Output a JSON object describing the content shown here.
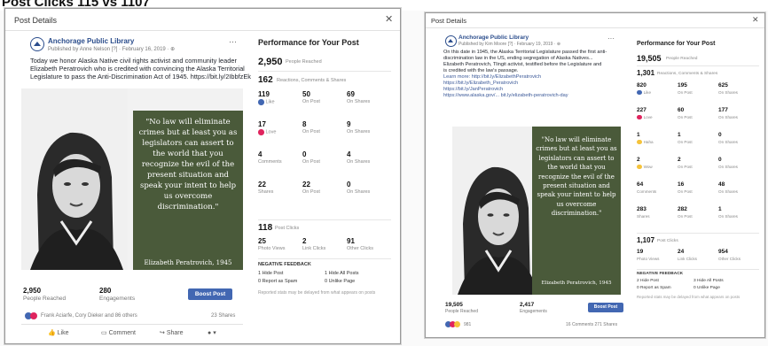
{
  "caption": "Post Clicks 115 vs 1107",
  "modal": {
    "title": "Post Details",
    "close_icon": "close-icon",
    "more_icon": "more-icon"
  },
  "left": {
    "page_name": "Anchorage Public Library",
    "meta": "Published by Anne Nelson [?] · February 16, 2019 · ",
    "post_lines": [
      "Today we honor Alaska Native civil rights activist and community leader",
      "Elizabeth Peratrovich who is credited with convincing the Alaska Territorial",
      "Legislature to pass the Anti-Discrimination Act of 1945. https://bit.ly/2IbbfzEk"
    ],
    "quote": "\"No law will eliminate crimes but at least you as legislators can assert to the world that you recognize the evil of the present situation and speak your intent to help us overcome discrimination.\"",
    "quote_attr": "Elizabeth Peratrovich, 1945",
    "reached": "2,950",
    "reached_label": "People Reached",
    "engagements": "280",
    "engagements_label": "Engagements",
    "boost": "Boost Post",
    "reactors": "Frank Aciarfe, Cory Dieker and 86 others",
    "shares": "23 Shares",
    "actions": {
      "like": "Like",
      "comment": "Comment",
      "share": "Share"
    },
    "perf": {
      "title": "Performance for Your Post",
      "reached": "2,950",
      "reached_label": "People Reached",
      "reactions": "162",
      "reactions_label": "Reactions, Comments & Shares",
      "grid": [
        {
          "n": "119",
          "l": "Like",
          "c": "#4267b2"
        },
        {
          "n": "50",
          "l": "On Post",
          "c": ""
        },
        {
          "n": "69",
          "l": "On Shares",
          "c": ""
        },
        {
          "n": "17",
          "l": "Love",
          "c": "#e0245e"
        },
        {
          "n": "8",
          "l": "On Post",
          "c": ""
        },
        {
          "n": "9",
          "l": "On Shares",
          "c": ""
        },
        {
          "n": "4",
          "l": "Comments",
          "c": ""
        },
        {
          "n": "0",
          "l": "On Post",
          "c": ""
        },
        {
          "n": "4",
          "l": "On Shares",
          "c": ""
        },
        {
          "n": "22",
          "l": "Shares",
          "c": ""
        },
        {
          "n": "22",
          "l": "On Post",
          "c": ""
        },
        {
          "n": "0",
          "l": "On Shares",
          "c": ""
        }
      ],
      "clicks": "118",
      "clicks_label": "Post Clicks",
      "click_grid": [
        {
          "n": "25",
          "l": "Photo Views"
        },
        {
          "n": "2",
          "l": "Link Clicks"
        },
        {
          "n": "91",
          "l": "Other Clicks"
        }
      ],
      "neg_title": "NEGATIVE FEEDBACK",
      "neg": [
        "1 Hide Post",
        "1 Hide All Posts",
        "0 Report as Spam",
        "0 Unlike Page"
      ],
      "note": "Reported stats may be delayed from what appears on posts"
    }
  },
  "right": {
    "page_name": "Anchorage Public Library",
    "meta": "Published by Kim Moore [?] · February 19, 2019 · ",
    "post_lines": [
      "On this date in 1945, the Alaska Territorial Legislature passed the first anti-",
      "discrimination law in the US, ending segregation of Alaska Natives...",
      "Elizabeth Peratrovich, Tlingit activist, testified before the Legislature and",
      "is credited with the law's passage.",
      "Learn more: http://bit.ly/ElizabethPeratrovich",
      "https://bit.ly/Elizabeth_Peratrovich",
      "https://bit.ly/JanPeratrovich",
      "https://www.alaska.gov/... bit.ly/elizabeth-peratrovich-day"
    ],
    "quote": "\"No law will eliminate crimes but at least you as legislators can assert to the world that you recognize the evil of the present situation and speak your intent to help us overcome discrimination.\"",
    "quote_attr": "Elizabeth Peratrovich, 1945",
    "reached": "19,505",
    "reached_label": "People Reached",
    "engagements": "2,417",
    "engagements_label": "Engagements",
    "boost": "Boost Post",
    "reactors": "981",
    "shares": "16 Comments 271 Shares",
    "perf": {
      "title": "Performance for Your Post",
      "reached": "19,505",
      "reached_label": "People Reached",
      "reactions": "1,301",
      "reactions_label": "Reactions, Comments & Shares",
      "grid": [
        {
          "n": "820",
          "l": "Like",
          "c": "#4267b2"
        },
        {
          "n": "195",
          "l": "On Post",
          "c": ""
        },
        {
          "n": "625",
          "l": "On Shares",
          "c": ""
        },
        {
          "n": "227",
          "l": "Love",
          "c": "#e0245e"
        },
        {
          "n": "60",
          "l": "On Post",
          "c": ""
        },
        {
          "n": "177",
          "l": "On Shares",
          "c": ""
        },
        {
          "n": "1",
          "l": "Haha",
          "c": "#f5c33b"
        },
        {
          "n": "1",
          "l": "On Post",
          "c": ""
        },
        {
          "n": "0",
          "l": "On Shares",
          "c": ""
        },
        {
          "n": "2",
          "l": "Wow",
          "c": "#f5c33b"
        },
        {
          "n": "2",
          "l": "On Post",
          "c": ""
        },
        {
          "n": "0",
          "l": "On Shares",
          "c": ""
        },
        {
          "n": "64",
          "l": "Comments",
          "c": ""
        },
        {
          "n": "16",
          "l": "On Post",
          "c": ""
        },
        {
          "n": "48",
          "l": "On Shares",
          "c": ""
        },
        {
          "n": "283",
          "l": "Shares",
          "c": ""
        },
        {
          "n": "282",
          "l": "On Post",
          "c": ""
        },
        {
          "n": "1",
          "l": "On Shares",
          "c": ""
        }
      ],
      "clicks": "1,107",
      "clicks_label": "Post Clicks",
      "click_grid": [
        {
          "n": "19",
          "l": "Photo Views"
        },
        {
          "n": "24",
          "l": "Link Clicks"
        },
        {
          "n": "954",
          "l": "Other Clicks"
        }
      ],
      "neg_title": "NEGATIVE FEEDBACK",
      "neg": [
        "2 Hide Post",
        "3 Hide All Posts",
        "0 Report as Spam",
        "0 Unlike Page"
      ],
      "note": "Reported stats may be delayed from what appears on posts"
    }
  }
}
